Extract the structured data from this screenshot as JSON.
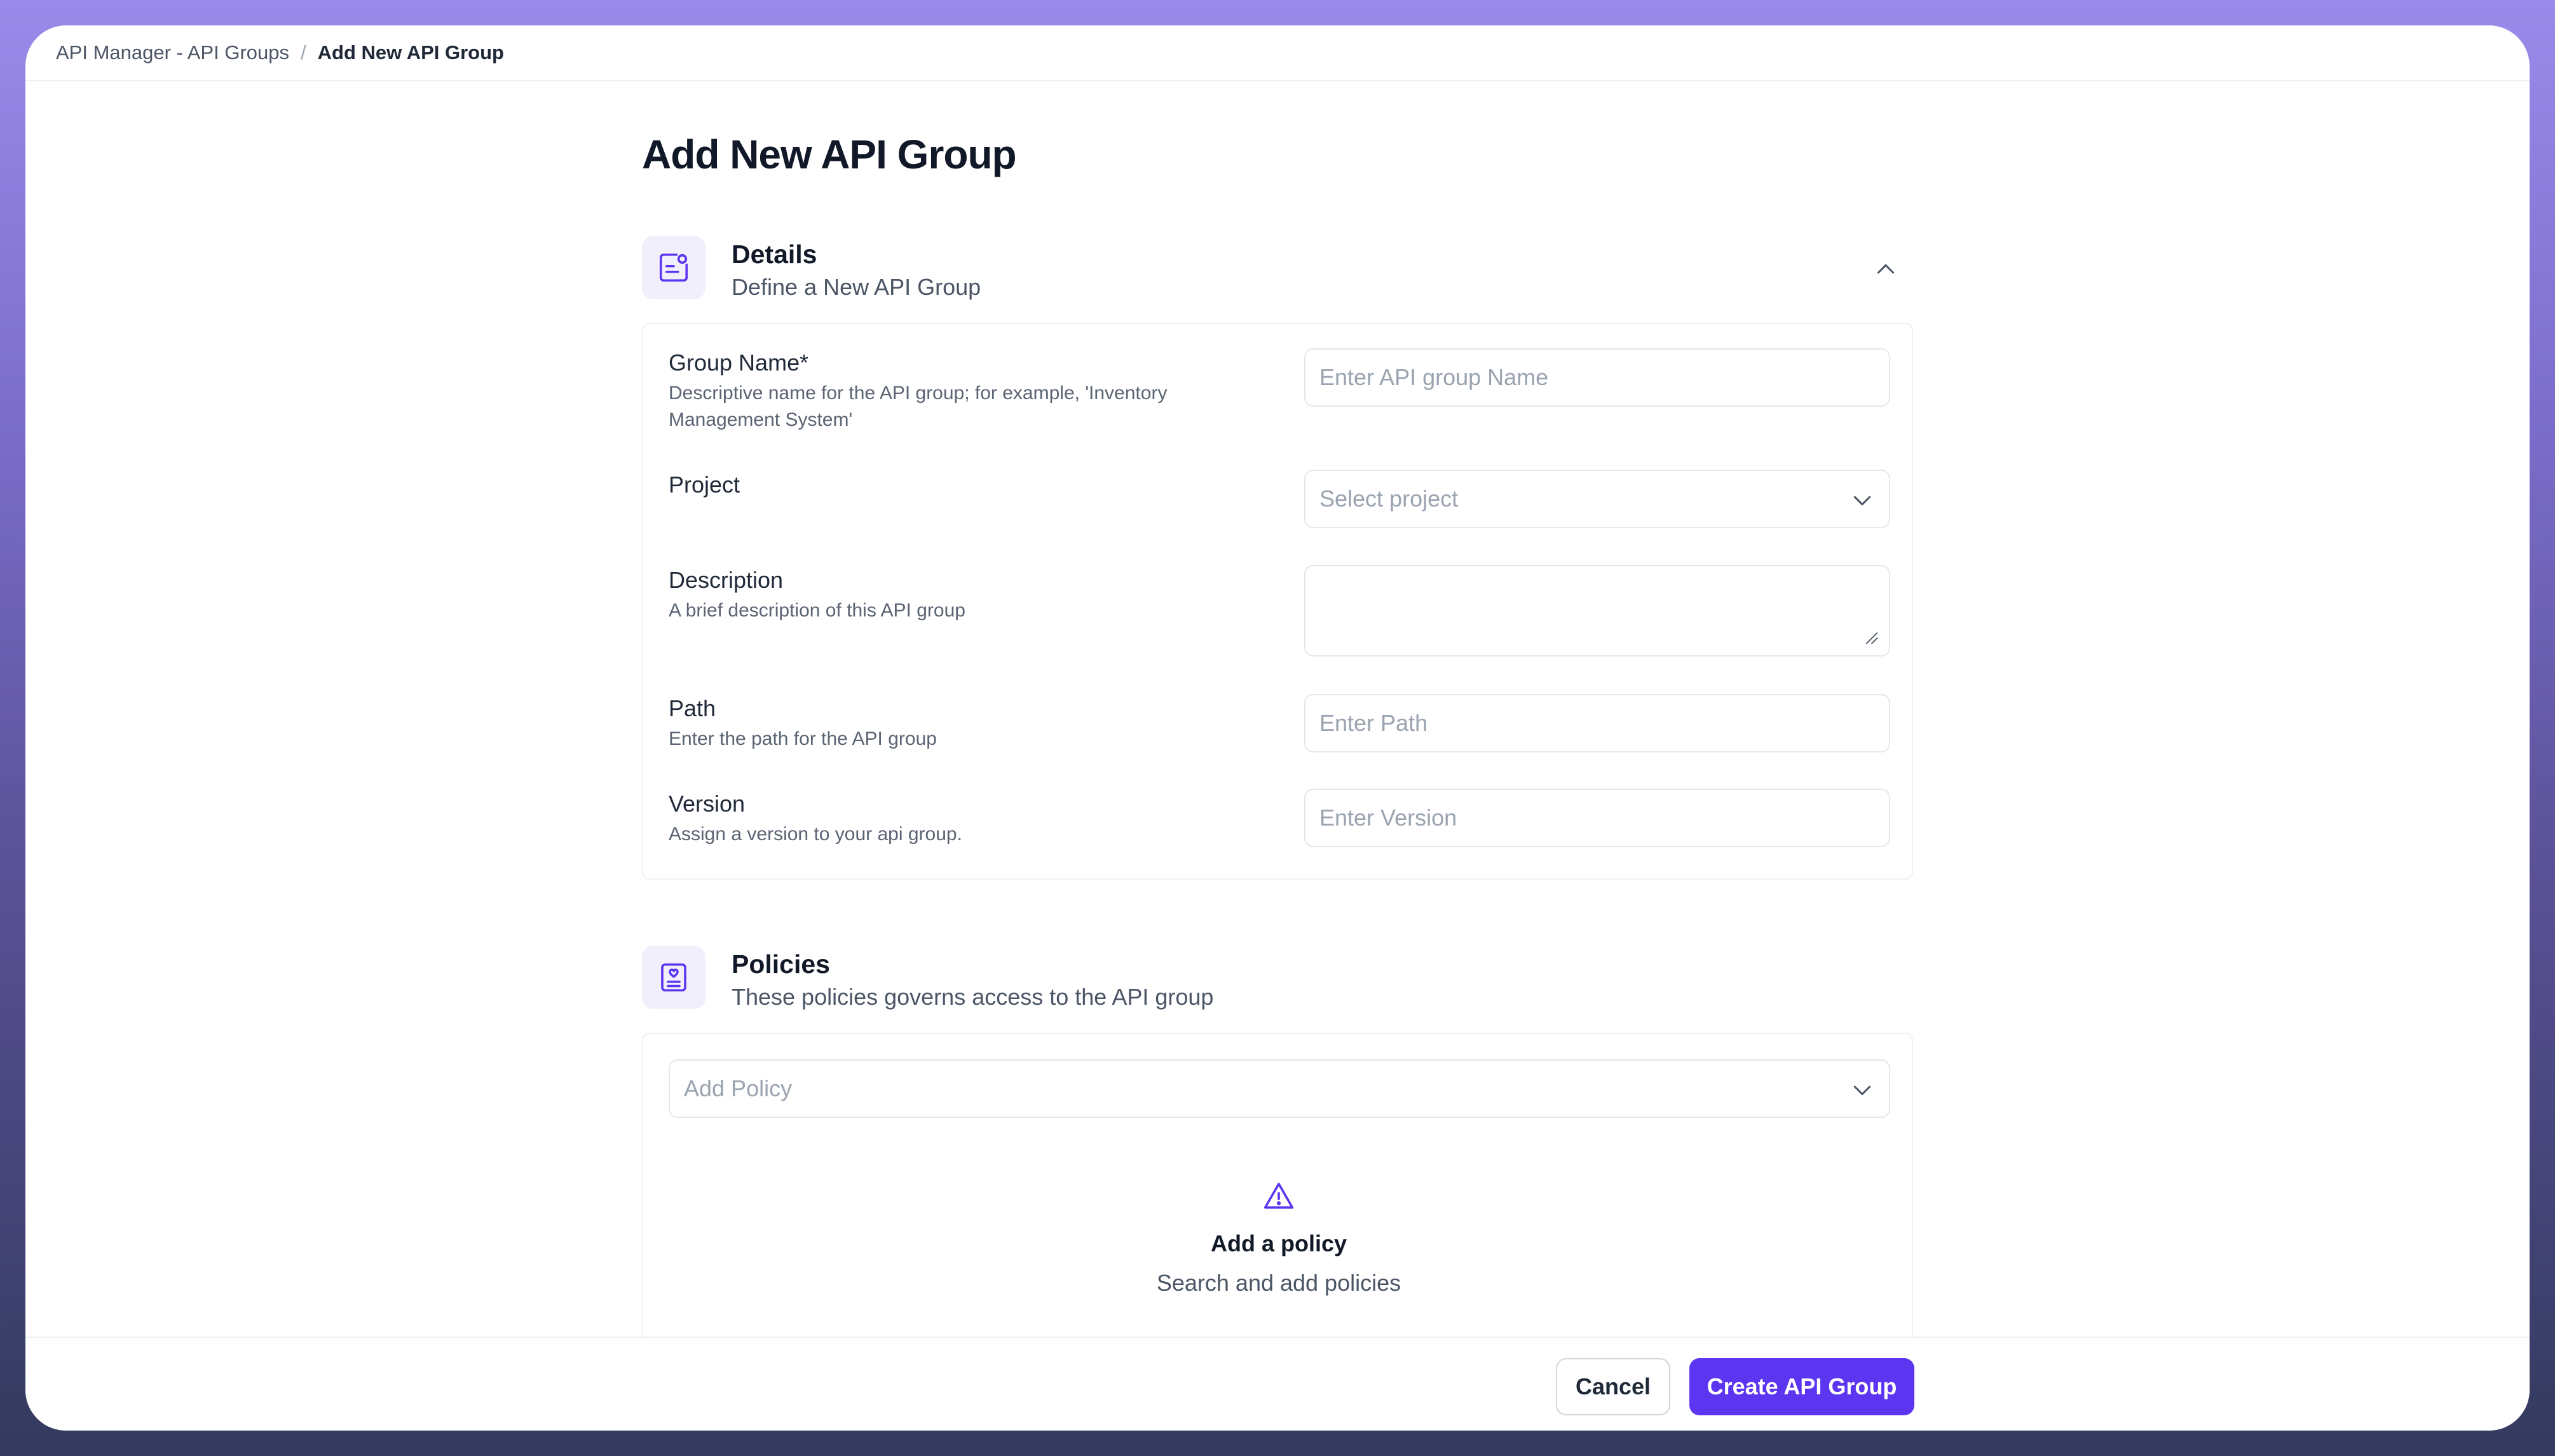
{
  "breadcrumb": {
    "parent": "API Manager - API Groups",
    "separator": "/",
    "current": "Add New API Group"
  },
  "page": {
    "title": "Add New API Group"
  },
  "details": {
    "title": "Details",
    "subtitle": "Define a New API Group",
    "icon": "document-user-icon",
    "fields": {
      "group_name": {
        "label": "Group Name*",
        "hint": "Descriptive name for the API group; for example, 'Inventory Management System'",
        "placeholder": "Enter API group Name"
      },
      "project": {
        "label": "Project",
        "placeholder": "Select project"
      },
      "description": {
        "label": "Description",
        "hint": "A brief description of this API group",
        "value": ""
      },
      "path": {
        "label": "Path",
        "hint": "Enter the path for the API group",
        "placeholder": "Enter Path"
      },
      "version": {
        "label": "Version",
        "hint": "Assign a version to your api group.",
        "placeholder": "Enter Version"
      }
    }
  },
  "policies": {
    "title": "Policies",
    "subtitle": "These policies governs access to the API group",
    "icon": "policy-badge-icon",
    "select_placeholder": "Add Policy",
    "empty_title": "Add a policy",
    "empty_subtitle": "Search and add policies"
  },
  "footer": {
    "cancel_label": "Cancel",
    "create_label": "Create API Group"
  },
  "colors": {
    "accent": "#5b35f0",
    "icon_bg": "#f1effc"
  }
}
